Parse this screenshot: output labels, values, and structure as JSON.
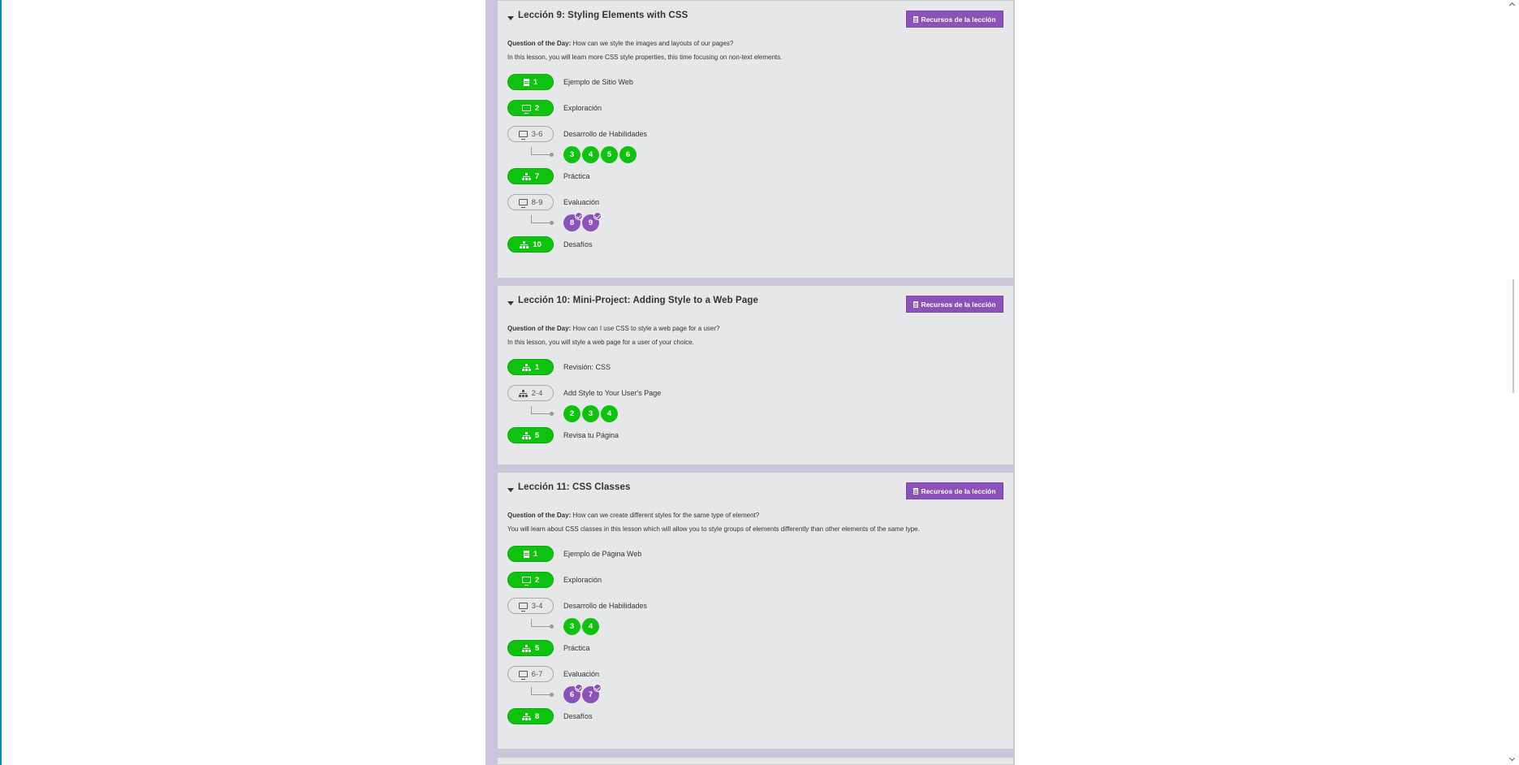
{
  "lessons": [
    {
      "title": "Lección 9: Styling Elements with CSS",
      "resources_label": "Recursos de la lección",
      "qotd_label": "Question of the Day:",
      "qotd": "How can we style the images and layouts of our pages?",
      "description": "In this lesson, you will learn more CSS style properties, this time focusing on non-text elements.",
      "items": [
        {
          "badge": "1",
          "icon": "document-icon",
          "style": "green",
          "label": "Ejemplo de Sitio Web"
        },
        {
          "badge": "2",
          "icon": "monitor-icon",
          "style": "green",
          "label": "Exploración"
        },
        {
          "badge": "3-6",
          "icon": "monitor-icon",
          "style": "outline",
          "label": "Desarrollo de Habilidades",
          "sub": [
            "3",
            "4",
            "5",
            "6"
          ],
          "sub_style": "green"
        },
        {
          "badge": "7",
          "icon": "hierarchy-icon",
          "style": "green",
          "label": "Práctica"
        },
        {
          "badge": "8-9",
          "icon": "monitor-icon",
          "style": "outline",
          "label": "Evaluación",
          "sub": [
            "8",
            "9"
          ],
          "sub_style": "purple"
        },
        {
          "badge": "10",
          "icon": "hierarchy-icon",
          "style": "green",
          "label": "Desafíos"
        }
      ]
    },
    {
      "title": "Lección 10: Mini-Project: Adding Style to a Web Page",
      "resources_label": "Recursos de la lección",
      "qotd_label": "Question of the Day:",
      "qotd": "How can I use CSS to style a web page for a user?",
      "description": "In this lesson, you will style a web page for a user of your choice.",
      "items": [
        {
          "badge": "1",
          "icon": "hierarchy-icon",
          "style": "green",
          "label": "Revisión: CSS"
        },
        {
          "badge": "2-4",
          "icon": "hierarchy-icon",
          "style": "outline",
          "label": "Add Style to Your User's Page",
          "sub": [
            "2",
            "3",
            "4"
          ],
          "sub_style": "green"
        },
        {
          "badge": "5",
          "icon": "hierarchy-icon",
          "style": "green",
          "label": "Revisa tu Página"
        }
      ]
    },
    {
      "title": "Lección 11: CSS Classes",
      "resources_label": "Recursos de la lección",
      "qotd_label": "Question of the Day:",
      "qotd": "How can we create different styles for the same type of element?",
      "description": "You will learn about CSS classes in this lesson which will allow you to style groups of elements differently than other elements of the same type.",
      "items": [
        {
          "badge": "1",
          "icon": "document-icon",
          "style": "green",
          "label": "Ejemplo de Página Web"
        },
        {
          "badge": "2",
          "icon": "monitor-icon",
          "style": "green",
          "label": "Exploración"
        },
        {
          "badge": "3-4",
          "icon": "monitor-icon",
          "style": "outline",
          "label": "Desarrollo de Habilidades",
          "sub": [
            "3",
            "4"
          ],
          "sub_style": "green"
        },
        {
          "badge": "5",
          "icon": "hierarchy-icon",
          "style": "green",
          "label": "Práctica"
        },
        {
          "badge": "6-7",
          "icon": "monitor-icon",
          "style": "outline",
          "label": "Evaluación",
          "sub": [
            "6",
            "7"
          ],
          "sub_style": "purple"
        },
        {
          "badge": "8",
          "icon": "hierarchy-icon",
          "style": "green",
          "label": "Desafíos"
        }
      ]
    }
  ],
  "colors": {
    "green": "#0dc30d",
    "purple": "#8c52ba",
    "card": "#e6e7e9",
    "column": "#cbc4dc"
  }
}
